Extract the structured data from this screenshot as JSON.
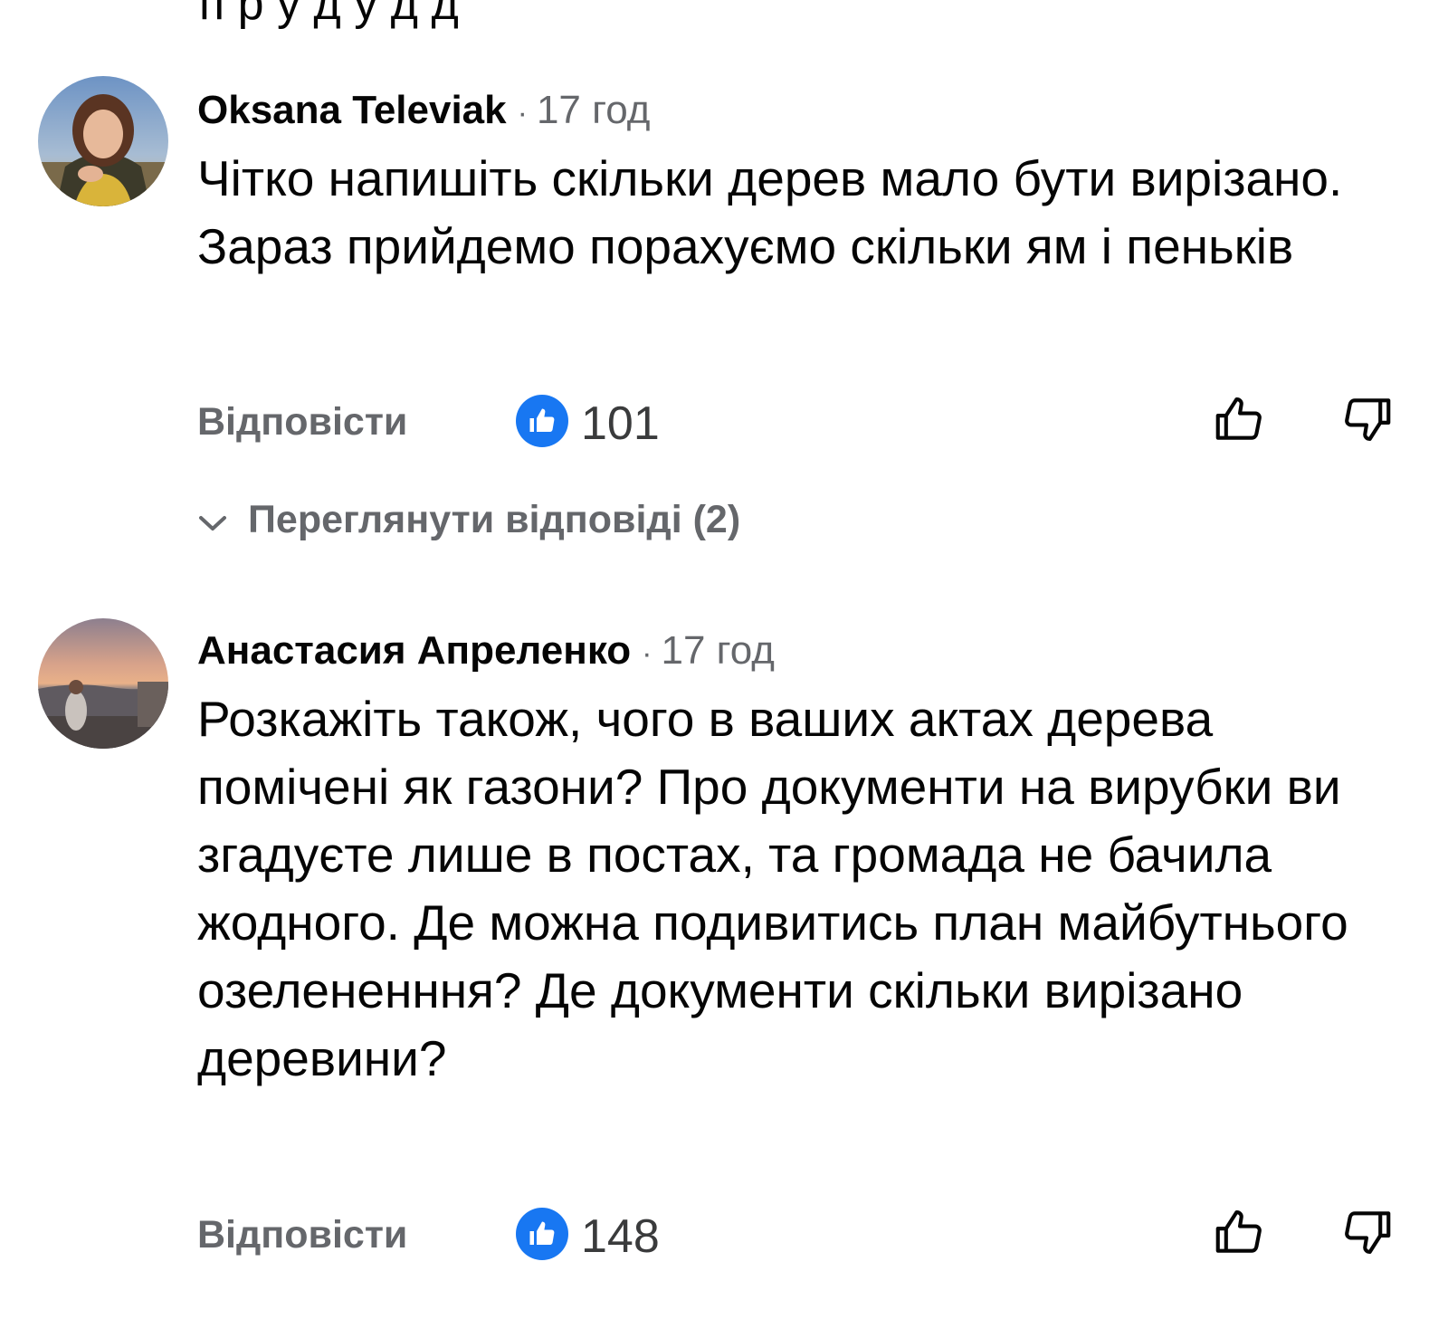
{
  "top_partial_text": "п  р   у   д у д    д",
  "comments": [
    {
      "author": "Oksana Televiak",
      "separator": "·",
      "time": "17 год",
      "text": "Чітко напишіть скільки дерев мало бути вирізано. Зараз прийдемо порахуємо скільки ям і пеньків",
      "reply_label": "Відповісти",
      "likes": "101",
      "view_replies_label": "Переглянути відповіді (2)",
      "avatar_icon": "profile-photo-woman",
      "like_icon": "thumbs-up-icon",
      "dislike_icon": "thumbs-down-icon"
    },
    {
      "author": "Анастасия Апреленко",
      "separator": "·",
      "time": "17 год",
      "text": "Розкажіть також, чого в ваших актах дерева помічені як газони? Про документи на вирубки ви згадуєте лише в постах, та громада не бачила жодного. Де можна подивитись план майбутнього озелененння? Де документи скільки вирізано деревини?",
      "reply_label": "Відповісти",
      "likes": "148",
      "avatar_icon": "profile-photo-sunset",
      "like_icon": "thumbs-up-icon",
      "dislike_icon": "thumbs-down-icon"
    }
  ],
  "colors": {
    "like_blue": "#1877f2",
    "secondary_text": "#65676b",
    "primary_text": "#050505"
  }
}
